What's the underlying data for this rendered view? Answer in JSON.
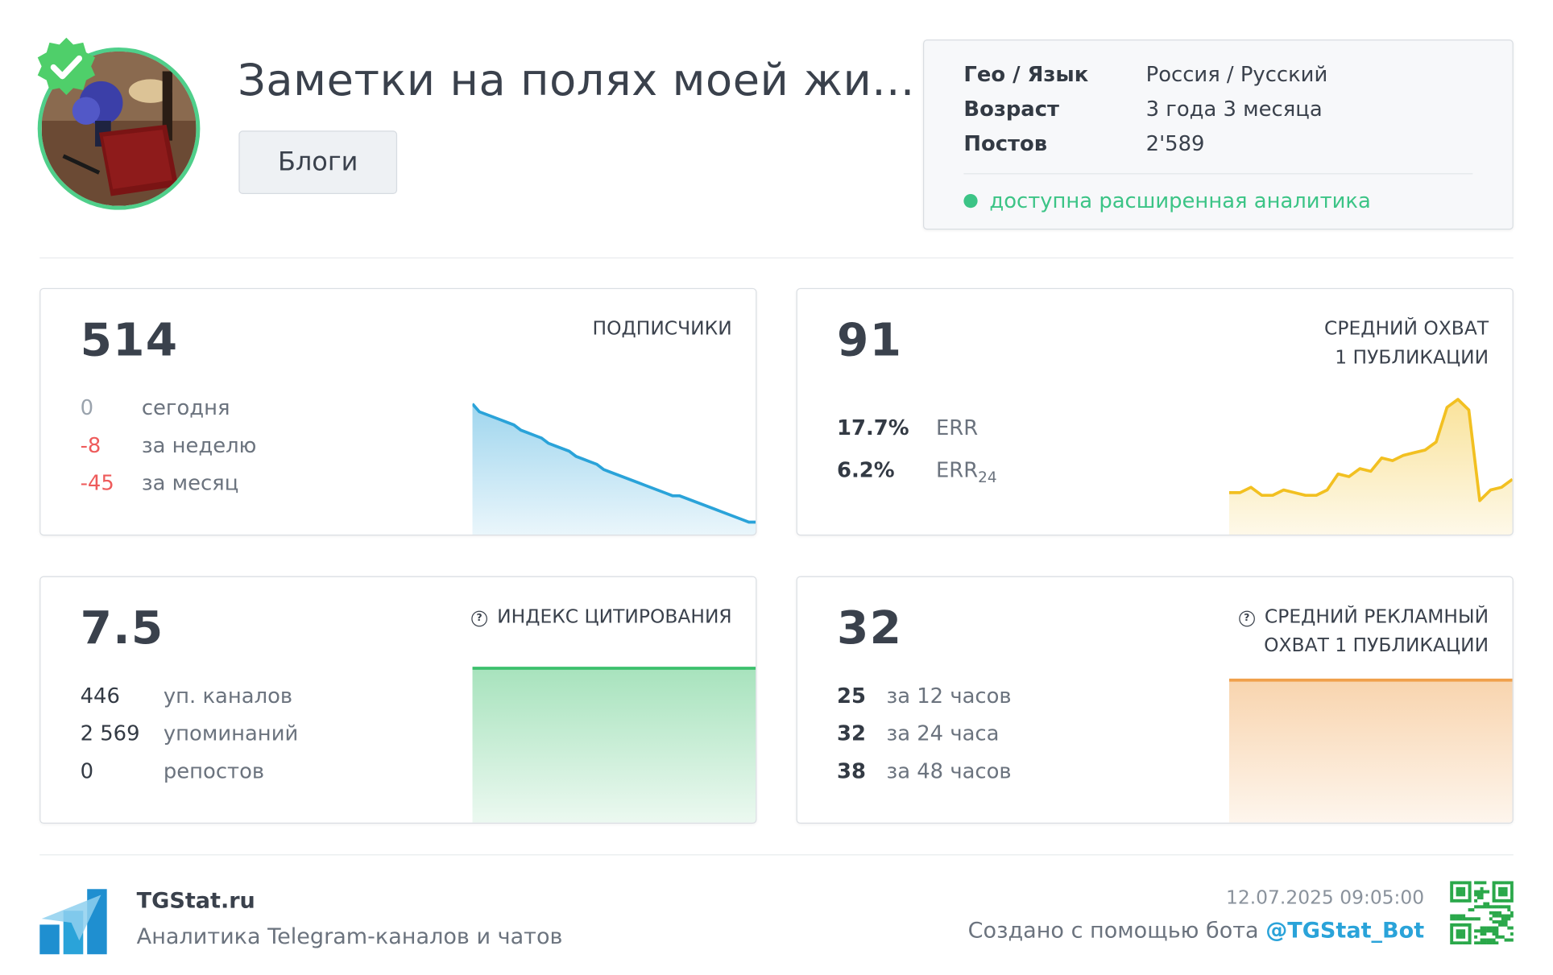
{
  "channel": {
    "title": "Заметки на полях моей жи...",
    "category": "Блоги",
    "verified": true
  },
  "info": {
    "rows": [
      {
        "key": "Гео / Язык",
        "value": "Россия / Русский"
      },
      {
        "key": "Возраст",
        "value": "3 года 3 месяца"
      },
      {
        "key": "Постов",
        "value": "2'589"
      }
    ],
    "analytics_note": "доступна расширенная аналитика"
  },
  "cards": {
    "subscribers": {
      "value": "514",
      "label": "ПОДПИСЧИКИ",
      "stats": [
        {
          "num": "0",
          "text": "сегодня"
        },
        {
          "num": "-8",
          "text": "за неделю"
        },
        {
          "num": "-45",
          "text": "за месяц"
        }
      ]
    },
    "reach": {
      "value": "91",
      "label_line1": "СРЕДНИЙ ОХВАТ",
      "label_line2": "1 ПУБЛИКАЦИИ",
      "stats": [
        {
          "num": "17.7%",
          "text": "ERR"
        },
        {
          "num": "6.2%",
          "text": "ERR",
          "sub": "24"
        }
      ]
    },
    "citation": {
      "value": "7.5",
      "label": "ИНДЕКС ЦИТИРОВАНИЯ",
      "stats": [
        {
          "num": "446",
          "text": "уп. каналов"
        },
        {
          "num": "2 569",
          "text": "упоминаний"
        },
        {
          "num": "0",
          "text": "репостов"
        }
      ]
    },
    "ad_reach": {
      "value": "32",
      "label_line1": "СРЕДНИЙ РЕКЛАМНЫЙ",
      "label_line2": "ОХВАТ 1 ПУБЛИКАЦИИ",
      "stats": [
        {
          "num": "25",
          "text": "за 12 часов"
        },
        {
          "num": "32",
          "text": "за 24 часа"
        },
        {
          "num": "38",
          "text": "за 48 часов"
        }
      ]
    }
  },
  "sparklines": {
    "subscribers": {
      "color": "#2aa3d9",
      "values": [
        559,
        556,
        555,
        554,
        553,
        552,
        551,
        549,
        548,
        547,
        546,
        544,
        543,
        542,
        541,
        539,
        538,
        537,
        536,
        534,
        533,
        532,
        531,
        530,
        529,
        528,
        527,
        526,
        525,
        524,
        524,
        523,
        522,
        521,
        520,
        519,
        518,
        517,
        516,
        515,
        514,
        514
      ]
    },
    "reach": {
      "color": "#f2c021",
      "values": [
        15,
        15,
        17,
        14,
        14,
        16,
        15,
        14,
        14,
        16,
        22,
        21,
        24,
        23,
        28,
        27,
        29,
        30,
        31,
        34,
        47,
        50,
        46,
        12,
        16,
        17,
        20
      ]
    },
    "citation": {
      "color": "#3cc06c",
      "values": [
        7.5,
        7.5,
        7.5,
        7.5,
        7.5,
        7.5
      ]
    },
    "ad_reach": {
      "color": "#f0a04b",
      "values": [
        32,
        32,
        32,
        32,
        32,
        32
      ]
    }
  },
  "footer": {
    "brand": "TGStat.ru",
    "tagline": "Аналитика Telegram-каналов и чатов",
    "timestamp": "12.07.2025 09:05:00",
    "created_with": "Создано с помощью бота ",
    "bot": "@TGStat_Bot"
  }
}
